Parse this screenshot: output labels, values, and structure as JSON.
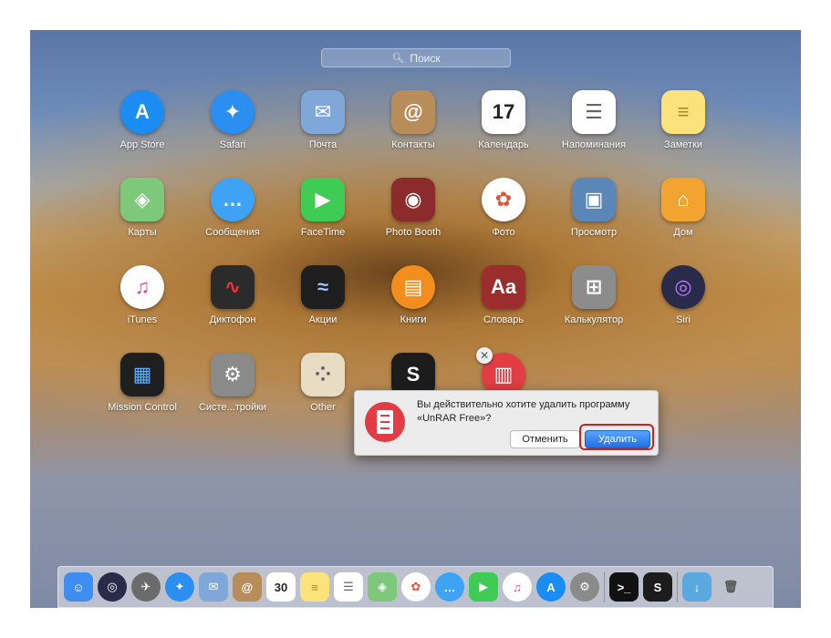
{
  "search": {
    "placeholder": "Поиск",
    "icon": "search-icon"
  },
  "apps": [
    {
      "label": "App Store",
      "icon": "app-store-icon",
      "glyph": "A",
      "bg": "#1b8cf2",
      "round": true
    },
    {
      "label": "Safari",
      "icon": "safari-icon",
      "glyph": "✦",
      "bg": "#2a8ff0",
      "round": true
    },
    {
      "label": "Почта",
      "icon": "mail-icon",
      "glyph": "✉",
      "bg": "#7fa8d8",
      "round": false
    },
    {
      "label": "Контакты",
      "icon": "contacts-icon",
      "glyph": "@",
      "bg": "#b98d5a",
      "round": false
    },
    {
      "label": "Календарь",
      "icon": "calendar-icon",
      "glyph": "17",
      "bg": "#ffffff",
      "fg": "#222",
      "round": false
    },
    {
      "label": "Напоминания",
      "icon": "reminders-icon",
      "glyph": "☰",
      "bg": "#ffffff",
      "fg": "#666",
      "round": false
    },
    {
      "label": "Заметки",
      "icon": "notes-icon",
      "glyph": "≡",
      "bg": "#fbe27a",
      "fg": "#a98b2a",
      "round": false
    },
    {
      "label": "Карты",
      "icon": "maps-icon",
      "glyph": "◈",
      "bg": "#7ec87c",
      "round": false
    },
    {
      "label": "Сообщения",
      "icon": "messages-icon",
      "glyph": "…",
      "bg": "#3fa3f5",
      "round": true
    },
    {
      "label": "FaceTime",
      "icon": "facetime-icon",
      "glyph": "▶",
      "bg": "#3fcc55",
      "round": false
    },
    {
      "label": "Photo Booth",
      "icon": "photo-booth-icon",
      "glyph": "◉",
      "bg": "#8b2b2b",
      "round": false
    },
    {
      "label": "Фото",
      "icon": "photos-icon",
      "glyph": "✿",
      "bg": "#ffffff",
      "fg": "#e0553a",
      "round": true
    },
    {
      "label": "Просмотр",
      "icon": "preview-icon",
      "glyph": "▣",
      "bg": "#5a86b8",
      "round": false
    },
    {
      "label": "Дом",
      "icon": "home-icon",
      "glyph": "⌂",
      "bg": "#f3a330",
      "round": false
    },
    {
      "label": "iTunes",
      "icon": "itunes-icon",
      "glyph": "♫",
      "bg": "#ffffff",
      "fg": "#e0448a",
      "round": true
    },
    {
      "label": "Диктофон",
      "icon": "voice-memos-icon",
      "glyph": "∿",
      "bg": "#2b2b2b",
      "fg": "#e33",
      "round": false
    },
    {
      "label": "Акции",
      "icon": "stocks-icon",
      "glyph": "≈",
      "bg": "#1e1e1e",
      "fg": "#9ac8ff",
      "round": false
    },
    {
      "label": "Книги",
      "icon": "books-icon",
      "glyph": "▤",
      "bg": "#f18e1c",
      "round": true
    },
    {
      "label": "Словарь",
      "icon": "dictionary-icon",
      "glyph": "Aa",
      "bg": "#9b2d2d",
      "round": false
    },
    {
      "label": "Калькулятор",
      "icon": "calculator-icon",
      "glyph": "⊞",
      "bg": "#8c8c8c",
      "round": false
    },
    {
      "label": "Siri",
      "icon": "siri-icon",
      "glyph": "◎",
      "bg": "#2a2a4a",
      "fg": "#b57cff",
      "round": true
    },
    {
      "label": "Mission Control",
      "icon": "mission-control-icon",
      "glyph": "▦",
      "bg": "#1f1f1f",
      "fg": "#5bb1ff",
      "round": false
    },
    {
      "label": "Систе...тройки",
      "icon": "system-preferences-icon",
      "glyph": "⚙",
      "bg": "#8a8a8a",
      "round": false
    },
    {
      "label": "Other",
      "icon": "other-folder-icon",
      "glyph": "⁘",
      "bg": "#e8dcc5",
      "fg": "#555",
      "round": false
    },
    {
      "label": "",
      "icon": "scrivener-icon",
      "glyph": "S",
      "bg": "#1c1c1c",
      "round": false
    },
    {
      "label": "",
      "icon": "unrar-icon",
      "glyph": "▥",
      "bg": "#e23c44",
      "round": true
    }
  ],
  "dialog": {
    "message": "Вы действительно хотите удалить программу «UnRAR Free»?",
    "cancel_label": "Отменить",
    "delete_label": "Удалить"
  },
  "dock": [
    {
      "name": "finder-icon",
      "glyph": "☺",
      "bg": "#3d8ef0"
    },
    {
      "name": "siri-icon",
      "glyph": "◎",
      "bg": "#2a2a4a",
      "round": true
    },
    {
      "name": "launchpad-icon",
      "glyph": "✈",
      "bg": "#6b6b6b",
      "round": true
    },
    {
      "name": "safari-icon",
      "glyph": "✦",
      "bg": "#2a8ff0",
      "round": true
    },
    {
      "name": "mail-icon",
      "glyph": "✉",
      "bg": "#7fa8d8"
    },
    {
      "name": "contacts-icon",
      "glyph": "@",
      "bg": "#b98d5a"
    },
    {
      "name": "calendar-icon",
      "glyph": "30",
      "bg": "#ffffff",
      "fg": "#222"
    },
    {
      "name": "notes-icon",
      "glyph": "≡",
      "bg": "#fbe27a",
      "fg": "#a98b2a"
    },
    {
      "name": "reminders-icon",
      "glyph": "☰",
      "bg": "#ffffff",
      "fg": "#666"
    },
    {
      "name": "maps-icon",
      "glyph": "◈",
      "bg": "#7ec87c"
    },
    {
      "name": "photos-icon",
      "glyph": "✿",
      "bg": "#ffffff",
      "fg": "#e0553a",
      "round": true
    },
    {
      "name": "messages-icon",
      "glyph": "…",
      "bg": "#3fa3f5",
      "round": true
    },
    {
      "name": "facetime-icon",
      "glyph": "▶",
      "bg": "#3fcc55"
    },
    {
      "name": "itunes-icon",
      "glyph": "♫",
      "bg": "#ffffff",
      "fg": "#e0448a",
      "round": true
    },
    {
      "name": "app-store-icon",
      "glyph": "A",
      "bg": "#1b8cf2",
      "round": true
    },
    {
      "name": "system-preferences-icon",
      "glyph": "⚙",
      "bg": "#8a8a8a",
      "round": true
    },
    {
      "sep": true
    },
    {
      "name": "terminal-icon",
      "glyph": ">_",
      "bg": "#111111"
    },
    {
      "name": "scrivener-icon",
      "glyph": "S",
      "bg": "#1c1c1c"
    },
    {
      "sep": true
    },
    {
      "name": "downloads-folder-icon",
      "glyph": "↓",
      "bg": "#5aa8e0"
    },
    {
      "name": "trash-icon",
      "glyph": "🗑",
      "bg": "transparent",
      "fg": "#555"
    }
  ]
}
